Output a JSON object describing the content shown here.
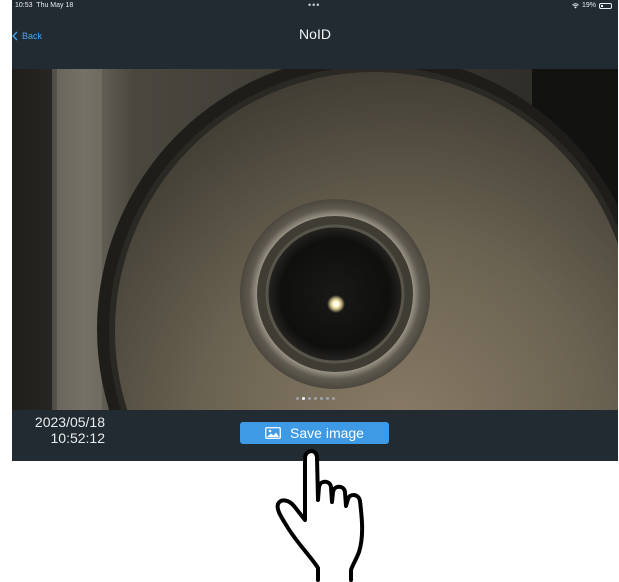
{
  "status_bar": {
    "time": "10:53",
    "date": "Thu May 18",
    "center_dots": "•••",
    "battery_text": "19%",
    "battery_level": 0.19
  },
  "nav": {
    "back_label": "Back",
    "title": "NoID"
  },
  "viewer": {
    "page_count": 7,
    "active_page": 1
  },
  "bottom": {
    "date": "2023/05/18",
    "time": "10:52:12",
    "save_label": "Save image",
    "save_icon": "image-icon"
  },
  "colors": {
    "accent": "#3f9ae5",
    "back_link": "#4aa3f0",
    "bar_background": "#222b31"
  }
}
